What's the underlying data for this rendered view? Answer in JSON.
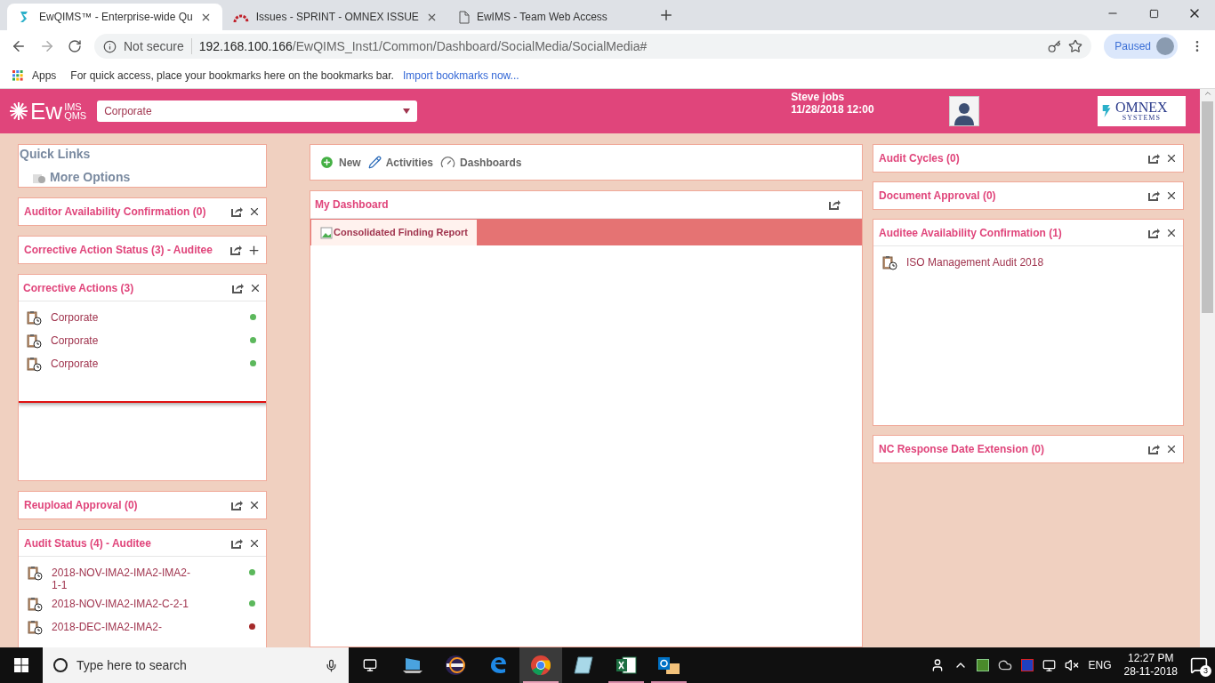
{
  "browser": {
    "tabs": [
      {
        "title": "EwQIMS™ - Enterprise-wide Qu",
        "kind": "app",
        "selected": true
      },
      {
        "title": "Issues - SPRINT - OMNEX ISSUE",
        "kind": "arc",
        "selected": false
      },
      {
        "title": "EwIMS - Team Web Access",
        "kind": "page",
        "selected": false
      }
    ],
    "security": "Not secure",
    "url_host": "192.168.100.166",
    "url_path": "/EwQIMS_Inst1/Common/Dashboard/SocialMedia/SocialMedia#",
    "profile": "Paused",
    "bookmarks": {
      "apps": "Apps",
      "hint": "For quick access, place your bookmarks here on the bookmarks bar.",
      "link": "Import bookmarks now..."
    }
  },
  "header": {
    "logo": {
      "main": "Ew",
      "top": "IMS",
      "bottom": "QMS"
    },
    "site": "Corporate",
    "user": "Steve jobs",
    "datetime": "11/28/2018 12:00",
    "company": {
      "name": "OMNEX",
      "sub": "SYSTEMS"
    }
  },
  "quick_links": {
    "title": "Quick Links",
    "items": [
      "More Options"
    ]
  },
  "left_widgets": [
    {
      "title": "Auditor Availability Confirmation (0)",
      "kind": "closable",
      "highlighted": false
    },
    {
      "title": "Corrective Action Status (3) - Auditee",
      "kind": "expandable",
      "highlighted": false
    },
    {
      "title": "Corrective Actions (3)",
      "kind": "closable",
      "highlighted": true,
      "items": [
        {
          "label": "Corporate",
          "color": "#5cb85c"
        },
        {
          "label": "Corporate",
          "color": "#5cb85c"
        },
        {
          "label": "Corporate",
          "color": "#5cb85c"
        }
      ]
    },
    {
      "title": "Reupload Approval (0)",
      "kind": "closable",
      "highlighted": false
    },
    {
      "title": "Audit Status (4) - Auditee",
      "kind": "closable",
      "highlighted": false,
      "items": [
        {
          "label": "2018-NOV-IMA2-IMA2-IMA2-1-1",
          "color": "#5cb85c"
        },
        {
          "label": "2018-NOV-IMA2-IMA2-C-2-1",
          "color": "#5cb85c"
        },
        {
          "label": "2018-DEC-IMA2-IMA2-",
          "color": "#a52a2a"
        }
      ]
    }
  ],
  "toolbar": [
    {
      "label": "New",
      "kind": "new"
    },
    {
      "label": "Activities",
      "kind": "activities"
    },
    {
      "label": "Dashboards",
      "kind": "dashboards"
    }
  ],
  "dashboard": {
    "title": "My Dashboard",
    "tabs": [
      {
        "label": "Consolidated Finding Report",
        "selected": true
      }
    ]
  },
  "right_widgets": [
    {
      "title": "Audit Cycles (0)",
      "kind": "closable"
    },
    {
      "title": "Document Approval (0)",
      "kind": "closable"
    },
    {
      "title": "Auditee Availability Confirmation (1)",
      "kind": "closable",
      "items": [
        {
          "label": "ISO Management Audit 2018"
        }
      ]
    },
    {
      "title": "NC Response Date Extension (0)",
      "kind": "closable"
    }
  ],
  "taskbar": {
    "search_placeholder": "Type here to search",
    "apps": [
      {
        "kind": "laptop",
        "running": false,
        "active": false
      },
      {
        "kind": "eclipse",
        "running": false,
        "active": false
      },
      {
        "kind": "edge",
        "running": false,
        "active": false
      },
      {
        "kind": "chrome",
        "running": true,
        "active": true
      },
      {
        "kind": "notepad",
        "running": false,
        "active": false
      },
      {
        "kind": "excel",
        "running": true,
        "active": false
      },
      {
        "kind": "outlook",
        "running": true,
        "active": false
      }
    ],
    "language": "ENG",
    "time": "12:27 PM",
    "date": "28-11-2018",
    "notifications": "3"
  }
}
